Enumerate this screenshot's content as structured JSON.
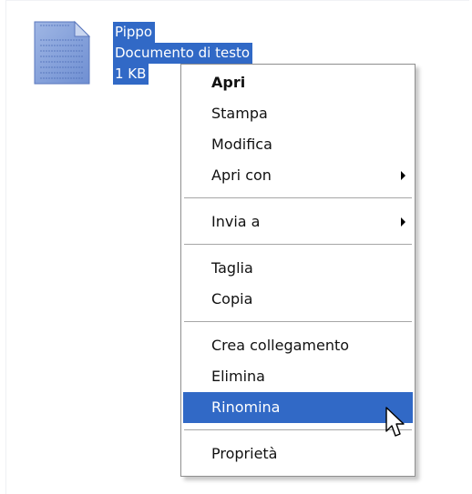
{
  "file": {
    "name": "Pippo",
    "type": "Documento di testo",
    "size": "1 KB",
    "icon": "text-document-icon"
  },
  "context_menu": {
    "open": "Apri",
    "print": "Stampa",
    "edit": "Modifica",
    "open_with": "Apri con",
    "send_to": "Invia a",
    "cut": "Taglia",
    "copy": "Copia",
    "create_shortcut": "Crea collegamento",
    "delete": "Elimina",
    "rename": "Rinomina",
    "properties": "Proprietà",
    "highlighted_item": "Rinomina"
  },
  "colors": {
    "selection": "#3169c6",
    "menu_background": "#ffffff",
    "menu_border": "#8f8f8f"
  },
  "cursor_icon": "arrow-cursor-icon"
}
